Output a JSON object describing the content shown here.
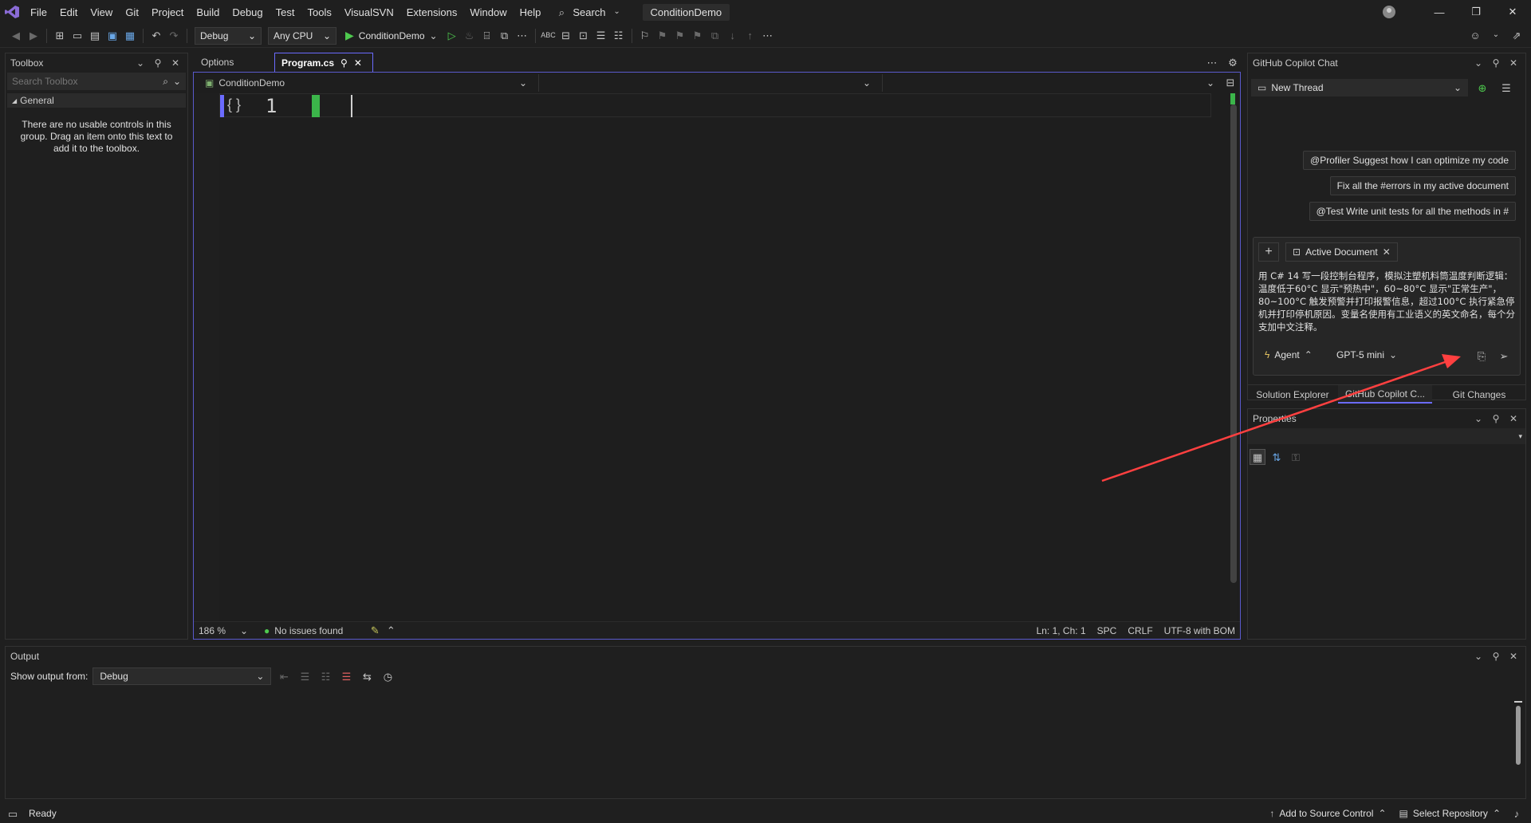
{
  "colors": {
    "accent": "#6b6bff",
    "run_green": "#4ec94e",
    "arrow": "#ff4040",
    "active_line": "#3bb54a"
  },
  "menu": [
    "File",
    "Edit",
    "View",
    "Git",
    "Project",
    "Build",
    "Debug",
    "Test",
    "Tools",
    "VisualSVN",
    "Extensions",
    "Window",
    "Help"
  ],
  "search_label": "Search",
  "solution_name": "ConditionDemo",
  "toolbar": {
    "config": "Debug",
    "platform": "Any CPU",
    "run_target": "ConditionDemo"
  },
  "toolbox": {
    "title": "Toolbox",
    "search_placeholder": "Search Toolbox",
    "group": "General",
    "empty_message": "There are no usable controls in this group. Drag an item onto this text to add it to the toolbox."
  },
  "editor": {
    "tabs": [
      {
        "label": "Options"
      },
      {
        "label": "Program.cs"
      }
    ],
    "nav_project": "ConditionDemo",
    "line_number": "1",
    "zoom": "186 %",
    "issues": "No issues found",
    "position": "Ln: 1, Ch: 1",
    "indent": "SPC",
    "line_ending": "CRLF",
    "encoding": "UTF-8 with BOM"
  },
  "copilot": {
    "title": "GitHub Copilot Chat",
    "thread": "New Thread",
    "suggestions": [
      "@Profiler Suggest how I can optimize my code",
      "Fix all the #errors in my active document",
      "@Test Write unit tests for all the methods in #"
    ],
    "context_chip": "Active Document",
    "prompt": "用 C# 14 写一段控制台程序，模拟注塑机料筒温度判断逻辑：温度低于60°C 显示\"预热中\"，60~80°C 显示\"正常生产\"，80~100°C 触发预警并打印报警信息，超过100°C 执行紧急停机并打印停机原因。变量名使用有工业语义的英文命名，每个分支加中文注释。",
    "mode": "Agent",
    "model": "GPT-5 mini"
  },
  "bottom_tabs": [
    "Solution Explorer",
    "GitHub Copilot C...",
    "Git Changes"
  ],
  "properties": {
    "title": "Properties"
  },
  "output": {
    "title": "Output",
    "show_from_label": "Show output from:",
    "source": "Debug"
  },
  "status": {
    "ready": "Ready",
    "source_control": "Add to Source Control",
    "repository": "Select Repository"
  }
}
